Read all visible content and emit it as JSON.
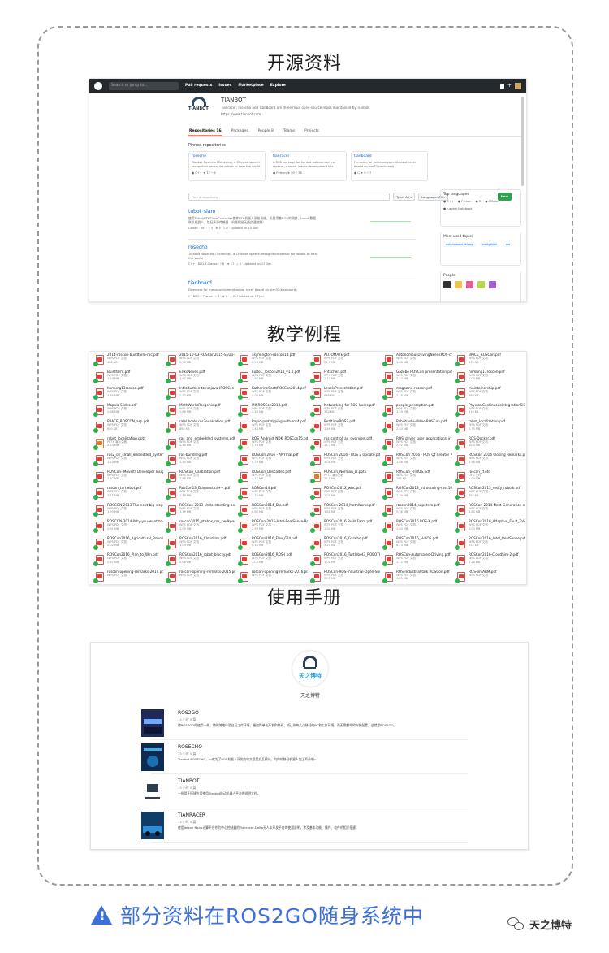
{
  "sections": {
    "s1": "开源资料",
    "s2": "教学例程",
    "s3": "使用手册"
  },
  "github": {
    "search_placeholder": "Search or jump to...",
    "nav": [
      "Pull requests",
      "Issues",
      "Marketplace",
      "Explore"
    ],
    "org_name": "TIANBOT",
    "org_logo_text": "TIANBOT",
    "org_desc": "Tianracer, rosecho and TianBoard are three main open-source repos maintained by Tianbot.",
    "org_url": "https://www.tianbot.com",
    "tabs": [
      "Repositories 16",
      "Packages",
      "People 8",
      "Teams",
      "Projects"
    ],
    "pinned_title": "Pinned repositories",
    "pinned": [
      {
        "name": "rosecho",
        "desc": "Tianbot Rosecho (Tianecho), a Chinese speech recognition sensor for robots to hear the world",
        "meta": "● C++  ★ 17  ⑂ 6",
        "color": "#f34b7d"
      },
      {
        "name": "tianracer",
        "desc": "A ROS package for tianbot autonomous ro racecar, a smart indoor development kits",
        "meta": "● Python  ★ 90  ⑂ 38",
        "color": "#3572A5"
      },
      {
        "name": "tianboard",
        "desc": "Firmware for mecanum/omni/tianbot racer based on stm32(tianboard)",
        "meta": "● C  ★ 9  ⑂ 7",
        "color": "#555555"
      }
    ],
    "find_placeholder": "Find a repository...",
    "type_btn": "Type: All ▾",
    "lang_btn": "Language: All ▾",
    "new_btn": "New",
    "repos": [
      {
        "name": "tubot_slam",
        "desc": "使用Tubot/RTKSlamController套件RTK机器人测绘系统，机器用基ROS的测控，tubot 数据联机机器人，包括多源传感器（机器视觉无线交通控制）",
        "meta": "CMake  ·  MIT  ·  ⑂ 3  ·  ★ 5  ·  ⓘ 0  ·  Updated on 10 Nov"
      },
      {
        "name": "rosecho",
        "desc": "Tianbot Rosecho (Tianecho), a Chinese speech recognition sensor for robots to hear the world",
        "meta": "C++  ·  BSD-3-Clause  ·  ⑂ 6  ·  ★ 17  ·  ⓘ 0  ·  Updated on 17 Dec"
      },
      {
        "name": "tianboard",
        "desc": "Firmware for mecanum/omni/tianbot racer based on stm32(tianboard)",
        "meta": "C  ·  BSD-3-Clause  ·  ⑂ 7  ·  ★ 9  ·  ⓘ 0  ·  Updated on 17 Jan"
      }
    ],
    "side": [
      {
        "title": "Top languages",
        "body": [
          "● C++",
          "● Python",
          "● C",
          "● CMake",
          "● Jupyter Notebook"
        ]
      },
      {
        "title": "Most used topics",
        "body": [
          "autonomous-driving",
          "navigation",
          "ros"
        ]
      },
      {
        "title": "People",
        "body": []
      }
    ]
  },
  "files": [
    {
      "n": "2014-roscon-buildfarm-roc.pdf",
      "t": "WPS PDF 文档",
      "s": "406 KB",
      "k": "pdf"
    },
    {
      "n": "2015-10-03-ROSCon2015-SEUU-N.pdf",
      "t": "WPS PDF 文档",
      "s": "2.72 MB",
      "k": "pdf"
    },
    {
      "n": "asymington-roscon14.pdf",
      "t": "WPS PDF 文档",
      "s": "2.53 MB",
      "k": "pdf"
    },
    {
      "n": "AUTOMATE.pdf",
      "t": "WPS PDF 文档",
      "s": "20.3 MB",
      "k": "pdf"
    },
    {
      "n": "AutonomousDrivingNeedsROS-cript.pdf",
      "t": "WPS PDF 文档",
      "s": "1.66 MB",
      "k": "pdf"
    },
    {
      "n": "BRICE_ROSCon.pdf",
      "t": "WPS PDF 文档",
      "s": "435 KB",
      "k": "pdf"
    },
    {
      "n": "Buildfarm.pdf",
      "t": "WPS PDF 文档",
      "s": "1.20 MB",
      "k": "pdf"
    },
    {
      "n": "EriksNeves.pdf",
      "t": "WPS PDF 文档",
      "s": "1.97 MB",
      "k": "pdf"
    },
    {
      "n": "EuRoC_roscon2014_v1.0.pdf",
      "t": "WPS PDF 文档",
      "s": "1.97 MB",
      "k": "pdf"
    },
    {
      "n": "Fritschen.pdf",
      "t": "WPS PDF 文档",
      "s": "1.12 MB",
      "k": "pdf"
    },
    {
      "n": "Gazebo ROSCon presentation.pdf",
      "t": "WPS PDF 文档",
      "s": "2.23 MB",
      "k": "pdf"
    },
    {
      "n": "homung13roscon.pdf",
      "t": "WPS PDF 文档",
      "s": "2.00 MB",
      "k": "pdf"
    },
    {
      "n": "homung13roscon.pdf",
      "t": "WPS PDF 文档",
      "s": "3.80 MB",
      "k": "pdf"
    },
    {
      "n": "Introduction to rosjava (ROSCon 2013).pdf",
      "t": "WPS PDF 文档",
      "s": "2.72 MB",
      "k": "pdf"
    },
    {
      "n": "KatherineScottROSCon2014.pdf",
      "t": "WPS PDF 文档",
      "s": "4.03 MB",
      "k": "pdf"
    },
    {
      "n": "LevelsPresentation.pdf",
      "t": "WPS PDF 文档",
      "s": "846 KB",
      "k": "pdf"
    },
    {
      "n": "magazine-roscon.pdf",
      "t": "WPS PDF 文档",
      "s": "3.38 MB",
      "k": "pdf"
    },
    {
      "n": "maintainership.pdf",
      "t": "WPS PDF 文档",
      "s": "489 KB",
      "k": "pdf"
    },
    {
      "n": "Mapviz Slides.pdf",
      "t": "WPS PDF 文档",
      "s": "2.68 MB",
      "k": "pdf"
    },
    {
      "n": "MathWorksRosgenie.pdf",
      "t": "WPS PDF 文档",
      "s": "2.86 MB",
      "k": "pdf"
    },
    {
      "n": "MISROSCon2013.pdf",
      "t": "WPS PDF 文档",
      "s": "4.53 MB",
      "k": "pdf"
    },
    {
      "n": "Networking-for-ROS-Users.pdf",
      "t": "WPS PDF 文档",
      "s": "362 KB",
      "k": "pdf"
    },
    {
      "n": "people_perception.pdf",
      "t": "WPS PDF 文档",
      "s": "1.39 MB",
      "k": "pdf"
    },
    {
      "n": "PhysicalContinuousIntegrationSlides.pdf",
      "t": "WPS PDF 文档",
      "s": "619 KB",
      "k": "pdf"
    },
    {
      "n": "PRACE_ROSCON_asp.pdf",
      "t": "WPS PDF 文档",
      "s": "690 KB",
      "k": "pdf"
    },
    {
      "n": "ralal.bcole.ros2evaluation.pdf",
      "t": "WPS PDF 文档",
      "s": "865 KB",
      "k": "pdf"
    },
    {
      "n": "Rapid-prototyping-with-ros4.pdf",
      "t": "WPS PDF 文档",
      "s": "1.46 MB",
      "k": "pdf"
    },
    {
      "n": "RealtimeROS2.pdf",
      "t": "WPS PDF 文档",
      "s": "1.46 MB",
      "k": "pdf"
    },
    {
      "n": "Robotiashi-slides-ROSCon.pdf",
      "t": "WPS PDF 文档",
      "s": "2.50 MB",
      "k": "pdf"
    },
    {
      "n": "robot_localization.pdf",
      "t": "WPS PDF 文档",
      "s": "2.75 MB",
      "k": "pdf"
    },
    {
      "n": "robot_localization.pptx",
      "t": "PPTX 演示文稿",
      "s": "2.23 MB",
      "k": "ppt"
    },
    {
      "n": "ros_and_embedded_systems.pdf",
      "t": "WPS PDF 文档",
      "s": "2.50 MB",
      "k": "pdf"
    },
    {
      "n": "ROS_Android_NDK_ROSCon15.pdf",
      "t": "WPS PDF 文档",
      "s": "5.79 MB",
      "k": "pdf"
    },
    {
      "n": "ros_control_an_overview.pdf",
      "t": "WPS PDF 文档",
      "s": "13.7 MB",
      "k": "pdf"
    },
    {
      "n": "ROS_driver_user_applications_in_development_environments.pdf",
      "t": "WPS PDF 文档",
      "s": "2.92 MB",
      "k": "pdf"
    },
    {
      "n": "ROS-Docker.pdf",
      "t": "WPS PDF 文档",
      "s": "10.4 MB",
      "k": "pdf"
    },
    {
      "n": "ros2_on_small_embedded_systems.pdf",
      "t": "WPS PDF 文档",
      "s": "1.20 MB",
      "k": "pdf"
    },
    {
      "n": "ros-bundling.pdf",
      "t": "WPS PDF 文档",
      "s": "2.50 MB",
      "k": "pdf"
    },
    {
      "n": "ROSCon 2016 - ANYmal.pdf",
      "t": "WPS PDF 文档",
      "s": "9.79 MB",
      "k": "pdf"
    },
    {
      "n": "ROSCon 2016 - ROS 2 Update.pdf",
      "t": "WPS PDF 文档",
      "s": "1.01 MB",
      "k": "pdf"
    },
    {
      "n": "ROSCon 2016 - ROS Qt Creator Plugin.pdf",
      "t": "WPS PDF 文档",
      "s": "1.68 MB",
      "k": "pdf"
    },
    {
      "n": "ROSCon 2016 Closing Remarks.pdf",
      "t": "WPS PDF 文档",
      "s": "4.98 MB",
      "k": "pdf"
    },
    {
      "n": "ROSCon- Movelt! Developer Insights.pdf",
      "t": "WPS PDF 文档",
      "s": "2.52 MB",
      "k": "pdf"
    },
    {
      "n": "ROSCon_Calibration.pdf",
      "t": "WPS PDF 文档",
      "s": "1.68 MB",
      "k": "pdf"
    },
    {
      "n": "ROSCon_Descartes.pdf",
      "t": "WPS PDF 文档",
      "s": "1.17 MB",
      "k": "pdf"
    },
    {
      "n": "ROSCon_Norman_LI.pptx",
      "t": "PPTX 演示文稿",
      "s": "21.5 MB",
      "k": "ppt"
    },
    {
      "n": "ROSCon_RTROS.pdf",
      "t": "WPS PDF 文档",
      "s": "765 KB",
      "k": "pdf"
    },
    {
      "n": "roscon_tf.ofd",
      "t": "OFD 文件",
      "s": "1.00 MB",
      "k": "ofd"
    },
    {
      "n": "roscon_turtlebot.pdf",
      "t": "WPS PDF 文档",
      "s": "7.11 MB",
      "k": "pdf"
    },
    {
      "n": "RosCon13_Diagnostics++.pdf",
      "t": "WPS PDF 文档",
      "s": "1.55 MB",
      "k": "pdf"
    },
    {
      "n": "ROSCon14.pdf",
      "t": "WPS PDF 文档",
      "s": "3.78 MB",
      "k": "pdf"
    },
    {
      "n": "ROSCon2012_wbc.pdf",
      "t": "WPS PDF 文档",
      "s": "1.01 MB",
      "k": "pdf"
    },
    {
      "n": "ROSCon2013_Introducing-rosc10010.pdf",
      "t": "WPS PDF 文档",
      "s": "2.39 MB",
      "k": "pdf"
    },
    {
      "n": "ROSCon2013_roslfy_roboik.pdf",
      "t": "WPS PDF 文档",
      "s": "382 KB",
      "k": "pdf"
    },
    {
      "n": "ROSCON-2013-The-next-big-step-for-the-ROS-middleware.pdf",
      "t": "WPS PDF 文档",
      "s": "1.39 MB",
      "k": "pdf"
    },
    {
      "n": "ROSCon-2013-Understanding-and-using-catkin-and-bloom.pdf",
      "t": "WPS PDF 文档",
      "s": "1.39 MB",
      "k": "pdf"
    },
    {
      "n": "ROSCon2014_Dia.pdf",
      "t": "WPS PDF 文档",
      "s": "6.68 MB",
      "k": "pdf"
    },
    {
      "n": "ROSCon-2014_MathWorks.pdf",
      "t": "WPS PDF 文档",
      "s": "1.81 MB",
      "k": "pdf"
    },
    {
      "n": "roscon2014_supetera.pdf",
      "t": "WPS PDF 文档",
      "s": "5.56 MB",
      "k": "pdf"
    },
    {
      "n": "ROSCon-2014-Next-Generation-of-ROS-on-top-of-DDS.pdf",
      "t": "WPS PDF 文档",
      "s": "1.85 MB",
      "k": "pdf"
    },
    {
      "n": "ROSCON-2014-Why-you-want-to-use-ROS-2.pdf",
      "t": "WPS PDF 文档",
      "s": "2.91 MB",
      "k": "pdf"
    },
    {
      "n": "roscon2015_ptabos_ros_swdkpack.pdf",
      "t": "WPS PDF 文档",
      "s": "1.09 MB",
      "k": "pdf"
    },
    {
      "n": "ROSCon-2015-Intel-RealSense-Robotics-Innovation-Program.pdf",
      "t": "WPS PDF 文档",
      "s": "2.99 MB",
      "k": "pdf"
    },
    {
      "n": "ROSCon2016 Build Farm.pdf",
      "t": "WPS PDF 文档",
      "s": "1.04 MB",
      "k": "pdf"
    },
    {
      "n": "ROSCon2016 ROS-X.pdf",
      "t": "WPS PDF 文档",
      "s": "1.04 MB",
      "k": "pdf"
    },
    {
      "n": "ROSCon2016_Adaptive_Fault_Tolerance.pdf",
      "t": "WPS PDF 文档",
      "s": "1.03 MB",
      "k": "pdf"
    },
    {
      "n": "ROSCon2016_Agricultural_Robotics.pdf",
      "t": "WPS PDF 文档",
      "s": "2.02 MB",
      "k": "pdf"
    },
    {
      "n": "ROSCon2016_Cloudsim.pdf",
      "t": "WPS PDF 文档",
      "s": "1.09 MB",
      "k": "pdf"
    },
    {
      "n": "ROSCon2016_Flex_GUI.pdf",
      "t": "WPS PDF 文档",
      "s": "6.44 MB",
      "k": "pdf"
    },
    {
      "n": "ROSCon2016_Gazebo.pdf",
      "t": "WPS PDF 文档",
      "s": "3.24 MB",
      "k": "pdf"
    },
    {
      "n": "ROSCon2016_H-ROS.pdf",
      "t": "WPS PDF 文档",
      "s": "6.44 MB",
      "k": "pdf"
    },
    {
      "n": "ROSCon2016_Intel_RealSense.pdf",
      "t": "WPS PDF 文档",
      "s": "932 KB",
      "k": "pdf"
    },
    {
      "n": "ROSCon2016_Plan_to_Win.pdf",
      "t": "WPS PDF 文档",
      "s": "2.67 MB",
      "k": "pdf"
    },
    {
      "n": "ROSCon2016_robot_blocky.pdf",
      "t": "WPS PDF 文档",
      "s": "2.08 MB",
      "k": "pdf"
    },
    {
      "n": "ROSCon2016_ROS-I.pdf",
      "t": "WPS PDF 文档",
      "s": "32.8 MB",
      "k": "pdf"
    },
    {
      "n": "ROSCon2016_Turtlebot3_ROBOTIS.pdf",
      "t": "WPS PDF 文档",
      "s": "1.01 MB",
      "k": "pdf"
    },
    {
      "n": "ROSCon-Automated-Driving.pdf",
      "t": "WPS PDF 文档",
      "s": "1.12 MB",
      "k": "pdf"
    },
    {
      "n": "ROSCon2016-CloudSim-2.pdf",
      "t": "WPS PDF 文档",
      "s": "2.28 MB",
      "k": "pdf"
    },
    {
      "n": "roscon-opening-remarks-2014.pdf",
      "t": "WPS PDF 文档",
      "s": "",
      "k": "pdf"
    },
    {
      "n": "roscon-opening-remarks-2015.pdf",
      "t": "WPS PDF 文档",
      "s": "",
      "k": "pdf"
    },
    {
      "n": "roscon-opening-remarks-2016.pdf",
      "t": "WPS PDF 文档",
      "s": "",
      "k": "pdf"
    },
    {
      "n": "ROSCon-ROS-Industrial-Open-Source-Case-Study-Rev-0.04.pdf",
      "t": "WPS PDF 文档",
      "s": "30.5 MB",
      "k": "pdf"
    },
    {
      "n": "ROS-Industrial talk ROSCon.pdf",
      "t": "WPS PDF 文档",
      "s": "30.5 MB",
      "k": "pdf"
    },
    {
      "n": "ROS-on-ARM.pdf",
      "t": "WPS PDF 文档",
      "s": "",
      "k": "pdf"
    }
  ],
  "manuals": {
    "logo_text": "天之博特",
    "brand": "天之博特",
    "items": [
      {
        "title": "ROS2GO",
        "meta": "15 小时 5 篇",
        "desc": "随ROS2GO的使用一样，随时随地体验自己工作环境，更加简单化开发和科研，或让你每几点移动的PC和工作环境，而无需额外的安装配置，这就是ROS2GO。",
        "cover": "ros2go"
      },
      {
        "title": "ROSECHO",
        "meta": "15 小时 5 篇",
        "desc": "Tianbot ROSECHO，一款为了ROS机器人开发的中文语音交互模块，为你的移动机器人加上耳朵吧~",
        "cover": "rosecho"
      },
      {
        "title": "TIANBOT",
        "meta": "15 小时 5 篇",
        "desc": "一份用于搭建应用使用Tianbot移动机器人平台的说明文档。",
        "cover": "tianbot"
      },
      {
        "title": "TIANRACER",
        "meta": "15 小时 5 篇",
        "desc": "使用Jetson Nano计算平台作为中心控制器的Tianracer-Delta无人车开发平台的使用说明，涉及基本功能、操作、软件的相关搭建。",
        "cover": "tianracer"
      }
    ]
  },
  "footer": {
    "warn_symbol": "!",
    "text": "部分资料在ROS2GO随身系统中",
    "wechat": "天之博特"
  }
}
